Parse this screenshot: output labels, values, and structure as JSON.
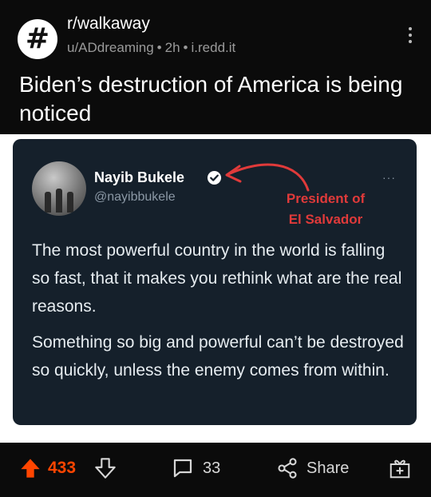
{
  "post": {
    "subreddit": "r/walkaway",
    "subreddit_icon": "#",
    "author": "u/ADdreaming",
    "age": "2h",
    "domain": "i.redd.it",
    "separator": "•",
    "title": "Biden’s destruction of America is being noticed"
  },
  "tweet": {
    "name": "Nayib Bukele",
    "handle": "@nayibbukele",
    "more": "···",
    "annotation_line1": "President of",
    "annotation_line2": "El Salvador",
    "annotation_color": "#e03a3a",
    "paragraph1": "The most powerful country in the world is falling so fast, that it makes you rethink what are the real reasons.",
    "paragraph2": "Something so big and powerful can’t be destroyed so quickly, unless the enemy comes from within."
  },
  "actions": {
    "upvotes": "433",
    "comments": "33",
    "share_label": "Share",
    "upvote_color": "#ff4500"
  }
}
